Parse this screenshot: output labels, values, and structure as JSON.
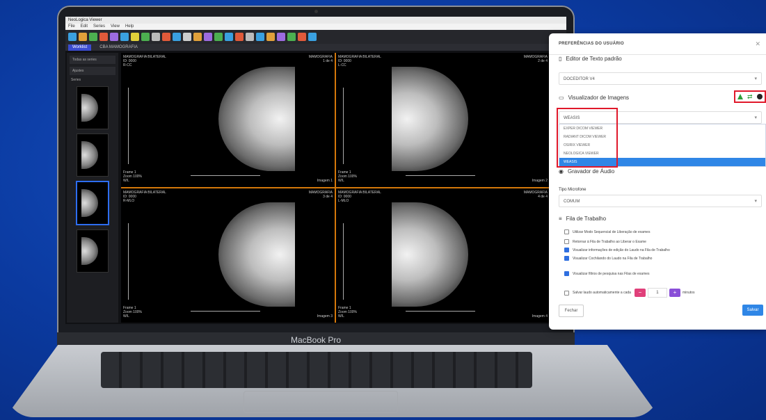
{
  "device": {
    "label": "MacBook Pro"
  },
  "app": {
    "window_title": "NeoLogica Viewer",
    "menus": [
      "File",
      "Edit",
      "Series",
      "View",
      "Help"
    ],
    "tabs": [
      {
        "label": "Worklist"
      },
      {
        "label": "CBA MAMOGRAFIA"
      }
    ],
    "left_panel": {
      "rows": [
        "Todas as series",
        "Ajustes"
      ],
      "series_label": "Series"
    },
    "viewports": [
      {
        "tl": "MAMOGRAFIA BILATERAL\nID: 0000\nR-CC",
        "tr": "MAMOGRAFIA\n1 de 4",
        "bl": "Frame 1\nZoom 100%\nW/L",
        "br": "Imagem 1",
        "orient": "left"
      },
      {
        "tl": "MAMOGRAFIA BILATERAL\nID: 0000\nL-CC",
        "tr": "MAMOGRAFIA\n2 de 4",
        "bl": "Frame 1\nZoom 100%\nW/L",
        "br": "Imagem 2",
        "orient": "right"
      },
      {
        "tl": "MAMOGRAFIA BILATERAL\nID: 0000\nR-MLO",
        "tr": "MAMOGRAFIA\n3 de 4",
        "bl": "Frame 1\nZoom 100%\nW/L",
        "br": "Imagem 3",
        "orient": "left"
      },
      {
        "tl": "MAMOGRAFIA BILATERAL\nID: 0000\nL-MLO",
        "tr": "MAMOGRAFIA\n4 de 4",
        "bl": "Frame 1\nZoom 100%\nW/L",
        "br": "Imagem 4",
        "orient": "right"
      }
    ]
  },
  "preferences": {
    "title": "PREFERÊNCIAS DO USUÁRIO",
    "text_editor": {
      "label": "Editor de Texto padrão",
      "value": "DOCEDITOR V4"
    },
    "image_viewer": {
      "label": "Visualizador de Imagens",
      "current": "WEASIS",
      "options": [
        "EXPER DICOM VIEWER",
        "RADIANT DICOM VIEWER",
        "OSIRIX VIEWER",
        "NEOLOGICA VIEWER",
        "WEASIS"
      ],
      "selected_index": 4
    },
    "audio_recorder": {
      "label": "Gravador de Áudio"
    },
    "microphone": {
      "label": "Tipo Microfone",
      "value": "COMUM"
    },
    "worklist": {
      "label": "Fila de Trabalho",
      "checks": [
        {
          "label": "Utilizar Modo Sequencial de Liberação de exames",
          "checked": false
        },
        {
          "label": "Retornar à Fila de Trabalho ao Liberar o Exame",
          "checked": false
        },
        {
          "label": "Visualizar informações de edição do Laudo na Fila de Trabalho",
          "checked": true
        },
        {
          "label": "Visualizar Cochilando do Laudo na Fila de Trabalho",
          "checked": true
        },
        {
          "label": "Visualizar filtros de pesquisa nas Filas de exames",
          "checked": true
        },
        {
          "label": "Salvar laudo automaticamente a cada",
          "checked": false
        }
      ],
      "autosave_minutes": "1",
      "minutes_label": "minutos"
    },
    "close_label": "Fechar",
    "save_label": "Salvar",
    "colors": {
      "accent": "#2f86e6",
      "highlight": "#e0182a",
      "minus": "#e0407a",
      "plus": "#8a4fd8"
    }
  }
}
